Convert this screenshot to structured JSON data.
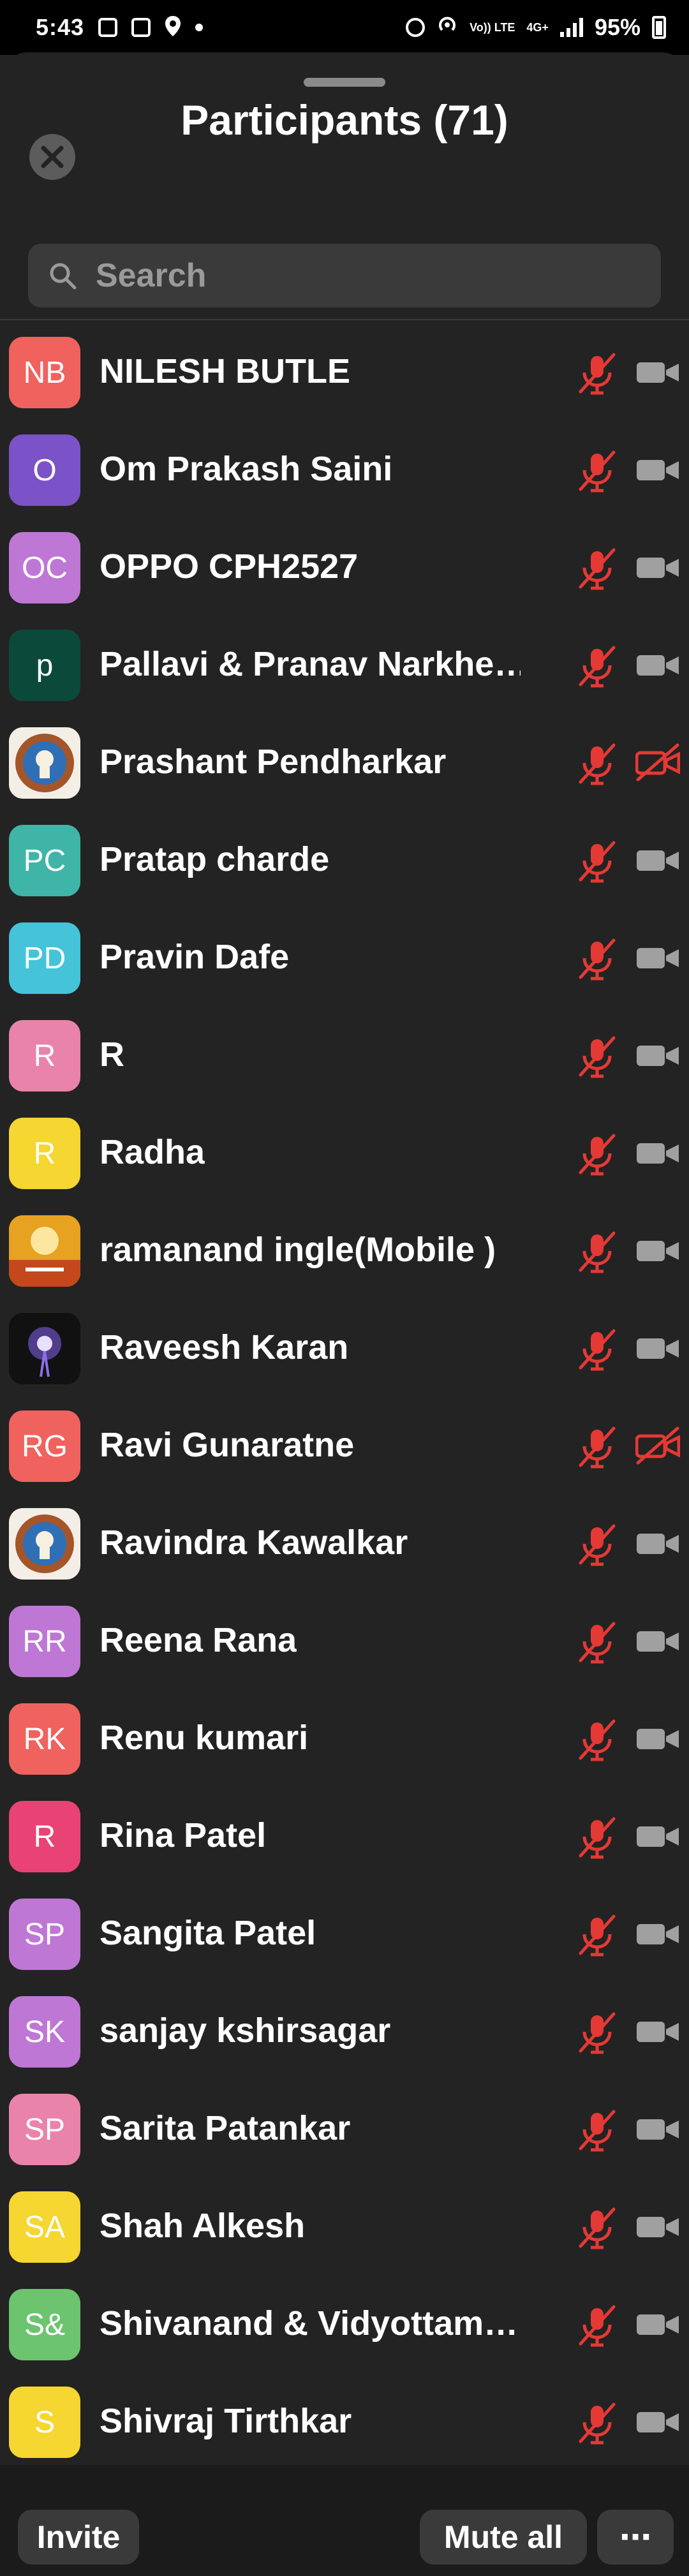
{
  "status_bar": {
    "time": "5:43",
    "network_top": "Vo)) LTE",
    "network_gen": "4G+",
    "battery": "95%"
  },
  "header": {
    "title": "Participants (71)"
  },
  "search": {
    "placeholder": "Search"
  },
  "colors": {
    "muted": "#e53935",
    "icon_gray": "#a0a0a0"
  },
  "participants": [
    {
      "initials": "NB",
      "name": "NILESH BUTLE",
      "color": "#f0625e",
      "avatar": "initials",
      "video_off": false
    },
    {
      "initials": "O",
      "name": "Om Prakash Saini",
      "color": "#7b52c7",
      "avatar": "initials",
      "video_off": false
    },
    {
      "initials": "OC",
      "name": "OPPO CPH2527",
      "color": "#be77d4",
      "avatar": "initials",
      "video_off": false
    },
    {
      "initials": "p",
      "name": "Pallavi & Pranav Narkhe…",
      "color": "#0b4a3a",
      "avatar": "initials",
      "video_off": false
    },
    {
      "initials": "",
      "name": "Prashant Pendharkar",
      "color": "#a4552a",
      "avatar": "image-emblem",
      "video_off": true
    },
    {
      "initials": "PC",
      "name": "Pratap charde",
      "color": "#3fb5a7",
      "avatar": "initials",
      "video_off": false
    },
    {
      "initials": "PD",
      "name": "Pravin Dafe",
      "color": "#45c3d9",
      "avatar": "initials",
      "video_off": false
    },
    {
      "initials": "R",
      "name": "R",
      "color": "#e983a9",
      "avatar": "initials",
      "video_off": false
    },
    {
      "initials": "R",
      "name": "Radha",
      "color": "#f6d630",
      "avatar": "initials",
      "video_off": false
    },
    {
      "initials": "",
      "name": "ramanand ingle(Mobile )",
      "color": "#e6a220",
      "avatar": "image-logo",
      "video_off": false
    },
    {
      "initials": "",
      "name": "Raveesh Karan",
      "color": "#111111",
      "avatar": "image-glow",
      "video_off": false
    },
    {
      "initials": "RG",
      "name": "Ravi Gunaratne",
      "color": "#f0625e",
      "avatar": "initials",
      "video_off": true
    },
    {
      "initials": "",
      "name": "Ravindra Kawalkar",
      "color": "#a4552a",
      "avatar": "image-emblem",
      "video_off": false
    },
    {
      "initials": "RR",
      "name": "Reena Rana",
      "color": "#be77d4",
      "avatar": "initials",
      "video_off": false
    },
    {
      "initials": "RK",
      "name": "Renu kumari",
      "color": "#f0625e",
      "avatar": "initials",
      "video_off": false
    },
    {
      "initials": "R",
      "name": "Rina Patel",
      "color": "#e84374",
      "avatar": "initials",
      "video_off": false
    },
    {
      "initials": "SP",
      "name": "Sangita Patel",
      "color": "#be77d4",
      "avatar": "initials",
      "video_off": false
    },
    {
      "initials": "SK",
      "name": "sanjay kshirsagar",
      "color": "#be77d4",
      "avatar": "initials",
      "video_off": false
    },
    {
      "initials": "SP",
      "name": "Sarita Patankar",
      "color": "#e983a9",
      "avatar": "initials",
      "video_off": false
    },
    {
      "initials": "SA",
      "name": "Shah Alkesh",
      "color": "#f6d630",
      "avatar": "initials",
      "video_off": false
    },
    {
      "initials": "S&",
      "name": "Shivanand & Vidyottam…",
      "color": "#6cc46f",
      "avatar": "initials",
      "video_off": false
    },
    {
      "initials": "S",
      "name": "Shivraj  Tirthkar",
      "color": "#f6d630",
      "avatar": "initials",
      "video_off": false
    }
  ],
  "footer": {
    "invite": "Invite",
    "mute_all": "Mute all",
    "more": "⋯"
  }
}
